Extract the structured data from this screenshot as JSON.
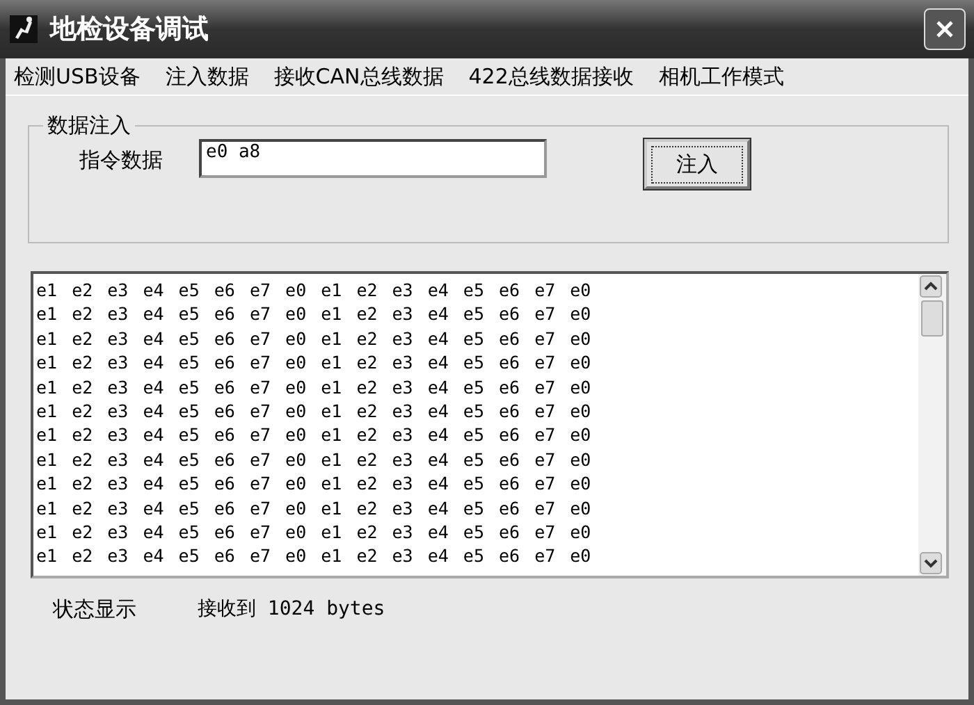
{
  "window": {
    "title": "地检设备调试"
  },
  "menu": [
    "检测USB设备",
    "注入数据",
    "接收CAN总线数据",
    "422总线数据接收",
    "相机工作模式"
  ],
  "group": {
    "title": "数据注入",
    "label": "指令数据",
    "field_value": "e0 a8",
    "button": "注入"
  },
  "output_lines": [
    "e1 e2 e3 e4 e5 e6 e7 e0 e1 e2 e3 e4 e5 e6 e7 e0",
    "e1 e2 e3 e4 e5 e6 e7 e0 e1 e2 e3 e4 e5 e6 e7 e0",
    "e1 e2 e3 e4 e5 e6 e7 e0 e1 e2 e3 e4 e5 e6 e7 e0",
    "e1 e2 e3 e4 e5 e6 e7 e0 e1 e2 e3 e4 e5 e6 e7 e0",
    "e1 e2 e3 e4 e5 e6 e7 e0 e1 e2 e3 e4 e5 e6 e7 e0",
    "e1 e2 e3 e4 e5 e6 e7 e0 e1 e2 e3 e4 e5 e6 e7 e0",
    "e1 e2 e3 e4 e5 e6 e7 e0 e1 e2 e3 e4 e5 e6 e7 e0",
    "e1 e2 e3 e4 e5 e6 e7 e0 e1 e2 e3 e4 e5 e6 e7 e0",
    "e1 e2 e3 e4 e5 e6 e7 e0 e1 e2 e3 e4 e5 e6 e7 e0",
    "e1 e2 e3 e4 e5 e6 e7 e0 e1 e2 e3 e4 e5 e6 e7 e0",
    "e1 e2 e3 e4 e5 e6 e7 e0 e1 e2 e3 e4 e5 e6 e7 e0",
    "e1 e2 e3 e4 e5 e6 e7 e0 e1 e2 e3 e4 e5 e6 e7 e0"
  ],
  "status": {
    "label": "状态显示",
    "value": "接收到 1024 bytes"
  }
}
